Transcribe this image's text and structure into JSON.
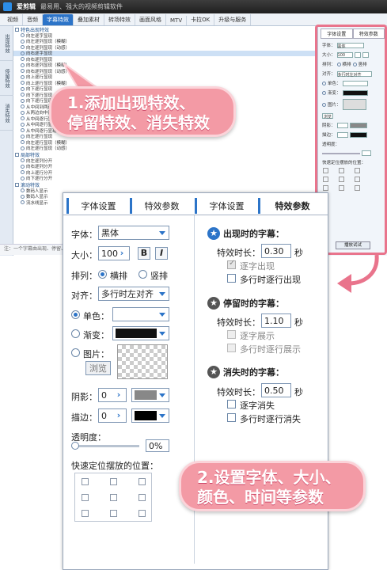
{
  "app": {
    "title": "爱剪辑",
    "subtitle": "最易用、强大的视频剪辑软件"
  },
  "menu": [
    "视频",
    "音频",
    "字幕特效",
    "叠加素材",
    "转场特效",
    "画面风格",
    "MTV",
    "卡拉OK",
    "升级与服务"
  ],
  "sidetabs": [
    "出现特效",
    "停留特效",
    "消失特效"
  ],
  "list": {
    "group1": "特色出现特效",
    "items1": [
      "向左逐字显现",
      "向左逐列显现（模糊）",
      "向左逐列显现（动感）",
      "向右逐字显现",
      "向右逐列显现",
      "向右逐列显现（模糊）",
      "向右逐列显现（动感）",
      "向上逐行显现",
      "向上逐行显现（模糊）",
      "向下逐行显现",
      "向下逐行显现（模糊）",
      "向下逐行显现（动感）",
      "从中间到两边显现",
      "从两边向中间显现",
      "从中间逐行显现",
      "从中间逐行显现（模糊）",
      "从中间逐行显现（动感）",
      "向左逐行显现",
      "向左逐行显现（模糊）",
      "向左逐行显现（动感）"
    ],
    "group2": "局部特效",
    "items2": [
      "向左逐列分开",
      "向右逐列分开",
      "向上逐行分开",
      "向下逐行分开"
    ],
    "group3": "滚动特效",
    "items3": [
      "数码人显示",
      "数码人显示",
      "流水线显示"
    ]
  },
  "status": "注：一个字幕由出现、停留、消失特效组成",
  "smallpanel": {
    "tab1": "字体设置",
    "tab2": "特效参数",
    "font": "字体：",
    "font_val": "黑体",
    "size": "大小：",
    "size_val": "100",
    "align_label": "排列：",
    "horiz": "横排",
    "vert": "竖排",
    "align2": "对齐：",
    "align2_val": "多行时左对齐",
    "single": "单色：",
    "grad": "渐变：",
    "image": "图片：",
    "browse": "浏览",
    "shadow": "阴影：",
    "stroke": "描边：",
    "opacity": "透明度：",
    "pos": "快速定位摆放的位置：",
    "btn": "播放试试"
  },
  "callouts": {
    "c1_line1": "1.添加出现特效、",
    "c1_line2": "停留特效、消失特效",
    "c2_line1": "2.设置字体、大小、",
    "c2_line2": "颜色、时间等参数"
  },
  "panel": {
    "tab_font": "字体设置",
    "tab_effect": "特效参数",
    "tab_font2": "字体设置",
    "tab_effect2": "特效参数",
    "font_label": "字体：",
    "font_value": "黑体",
    "size_label": "大小：",
    "size_value": "100",
    "bold": "B",
    "italic": "I",
    "layout_label": "排列：",
    "horizontal": "横排",
    "vertical": "竖排",
    "align_label": "对齐：",
    "align_value": "多行时左对齐",
    "single_color": "单色：",
    "gradient": "渐变：",
    "image": "图片：",
    "browse": "浏览",
    "shadow_label": "阴影：",
    "shadow_value": "0",
    "stroke_label": "描边：",
    "stroke_value": "0",
    "opacity_label": "透明度：",
    "opacity_value": "0%",
    "position_label": "快速定位摆放的位置：",
    "appear_title": "出现时的字幕：",
    "appear_dur_label": "特效时长：",
    "appear_dur": "0.30",
    "sec": "秒",
    "appear_opt1": "逐字出现",
    "appear_opt2": "多行时逐行出现",
    "stay_title": "停留时的字幕：",
    "stay_dur_label": "特效时长：",
    "stay_dur": "1.10",
    "stay_opt1": "逐字展示",
    "stay_opt2": "多行时逐行展示",
    "vanish_title": "消失时的字幕：",
    "vanish_dur_label": "特效时长：",
    "vanish_dur": "0.50",
    "vanish_opt1": "逐字消失",
    "vanish_opt2": "多行时逐行消失"
  },
  "colors": {
    "accent": "#2c74c8",
    "callout": "#f39aa5",
    "frame": "#e9748c"
  }
}
